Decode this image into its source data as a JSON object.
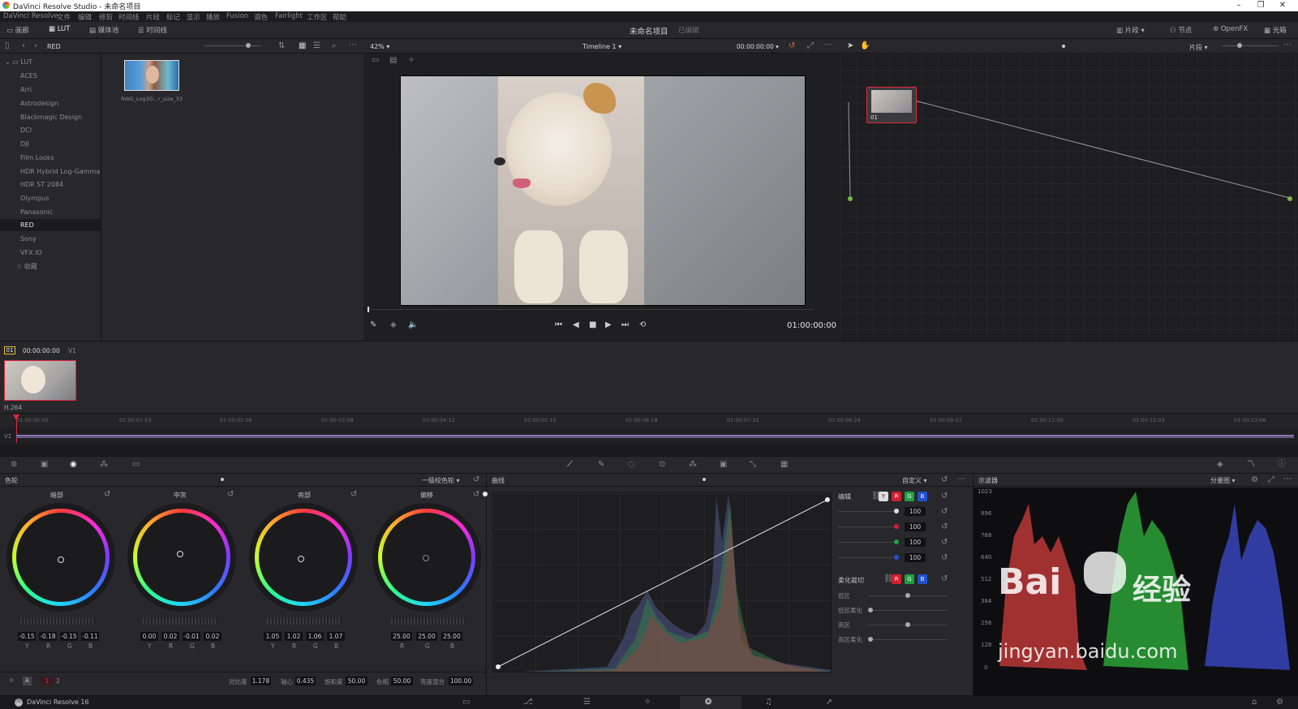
{
  "window": {
    "title": "DaVinci Resolve Studio - 未命名项目"
  },
  "menu": [
    "DaVinci Resolve",
    "文件",
    "编辑",
    "修剪",
    "时间线",
    "片段",
    "标记",
    "显示",
    "播放",
    "Fusion",
    "调色",
    "Fairlight",
    "工作区",
    "帮助"
  ],
  "toolbar": {
    "gallery": "画廊",
    "lut": "LUT",
    "media_pool": "媒体池",
    "timeline": "时间线",
    "project_name": "未命名项目",
    "edited": "已编辑",
    "clips": "片段",
    "nodes": "节点",
    "openfx": "OpenFX",
    "lightbox": "光箱"
  },
  "lut_browser": {
    "current": "RED",
    "root": "LUT",
    "items": [
      "ACES",
      "Arri",
      "Astrodesign",
      "Blackmagic Design",
      "DCI",
      "DJI",
      "Film Looks",
      "HDR Hybrid Log-Gamma",
      "HDR ST 2084",
      "Olympus",
      "Panasonic",
      "RED",
      "Sony",
      "VFX IO"
    ],
    "favorites": "收藏",
    "thumb_label": "RWG_Log3G...r_size_33"
  },
  "viewer": {
    "zoom": "42%",
    "timeline_name": "Timeline 1",
    "timecode_top": "00:00:00:00",
    "timecode": "01:00:00:00",
    "clip_mode": "片段"
  },
  "clips_strip": {
    "clip_number": "01",
    "clip_tc": "00:00:00:00",
    "track": "V1",
    "codec": "H.264"
  },
  "ruler": {
    "track": "V1",
    "ticks": [
      "01:00:00:00",
      "01:00:01:03",
      "01:00:02:06",
      "01:00:03:09",
      "01:00:04:12",
      "01:00:05:15",
      "01:00:06:18",
      "01:00:07:21",
      "01:00:08:24",
      "01:00:09:27",
      "01:00:11:00",
      "01:00:12:03",
      "01:00:13:06"
    ]
  },
  "node": {
    "label": "01"
  },
  "color_wheels": {
    "title": "色轮",
    "mode": "一级校色轮",
    "wheels": [
      {
        "name": "暗部",
        "values": [
          "-0.15",
          "-0.18",
          "-0.15",
          "-0.11"
        ],
        "chan": [
          "Y",
          "R",
          "G",
          "B"
        ]
      },
      {
        "name": "中灰",
        "values": [
          "0.00",
          "0.02",
          "-0.01",
          "0.02"
        ],
        "chan": [
          "Y",
          "R",
          "G",
          "B"
        ]
      },
      {
        "name": "亮部",
        "values": [
          "1.05",
          "1.02",
          "1.06",
          "1.07"
        ],
        "chan": [
          "Y",
          "R",
          "G",
          "B"
        ]
      },
      {
        "name": "偏移",
        "values": [
          "25.00",
          "25.00",
          "25.00"
        ],
        "chan": [
          "R",
          "G",
          "B"
        ]
      }
    ],
    "footer": {
      "page1": "1",
      "page2": "2",
      "contrast_label": "对比度",
      "contrast": "1.178",
      "pivot_label": "轴心",
      "pivot": "0.435",
      "sat_label": "饱和度",
      "sat": "50.00",
      "hue_label": "色相",
      "hue": "50.00",
      "lummix_label": "亮度混合",
      "lummix": "100.00"
    }
  },
  "curves": {
    "title": "曲线",
    "mode": "自定义",
    "edit_label": "编辑",
    "intensity": [
      "100",
      "100",
      "100",
      "100"
    ],
    "soft_clip": "柔化裁切",
    "low": "低区",
    "low_soft": "低区柔化",
    "high": "高区",
    "high_soft": "高区柔化"
  },
  "scope": {
    "title": "示波器",
    "mode": "分量图",
    "axis": [
      "1023",
      "896",
      "768",
      "640",
      "512",
      "384",
      "256",
      "128",
      "0"
    ]
  },
  "watermark": {
    "brand": "Bai",
    "cn": "经验",
    "url": "jingyan.baidu.com"
  },
  "footer": {
    "app": "DaVinci Resolve 16"
  },
  "colors": {
    "accent_red": "#e0283a",
    "panel": "#28282c",
    "bg": "#1a1a1d"
  }
}
